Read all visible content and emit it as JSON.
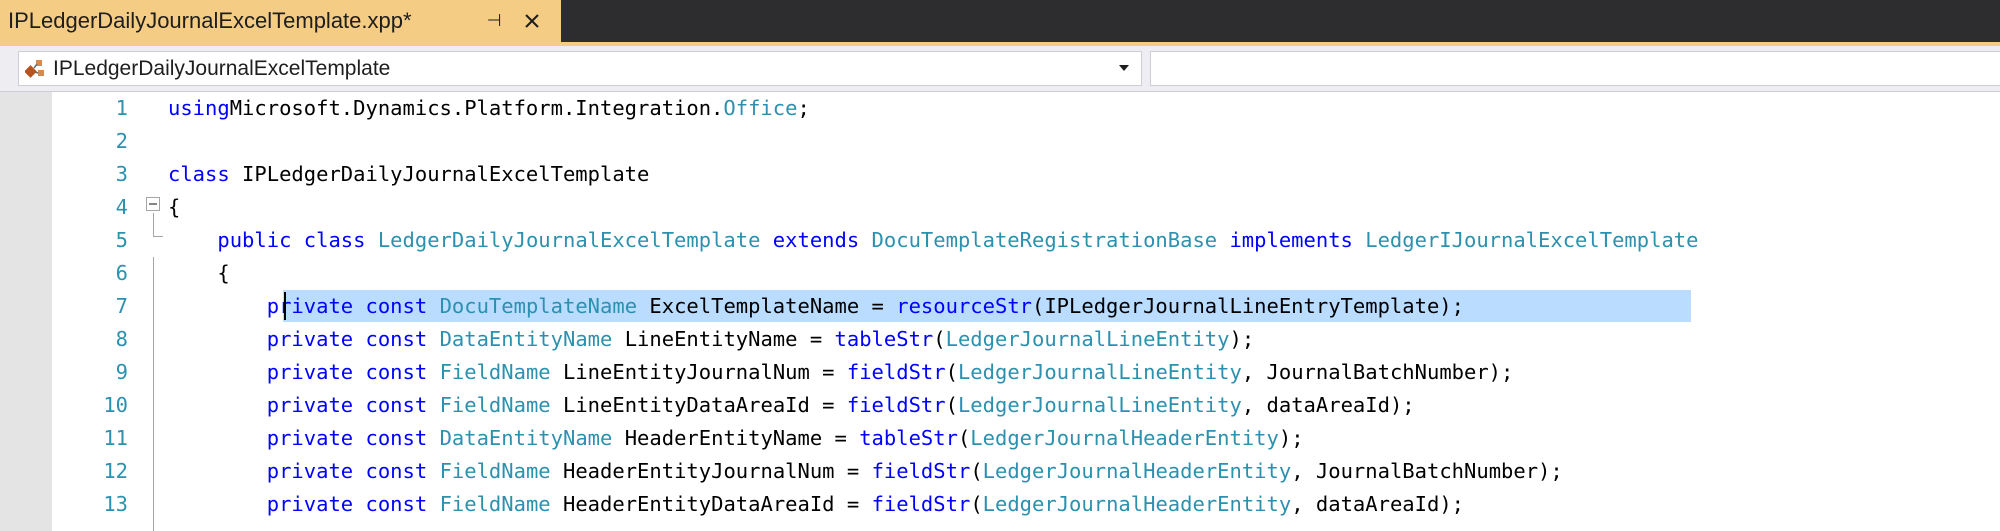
{
  "tab": {
    "title": "IPLedgerDailyJournalExcelTemplate.xpp*",
    "pin_glyph": "⊣",
    "close_icon": "close-icon"
  },
  "navbar": {
    "selected": "IPLedgerDailyJournalExcelTemplate",
    "icon": "class-icon"
  },
  "colors": {
    "tab_active": "#f5cc84",
    "keyword": "#0000ff",
    "type": "#2b91af",
    "line_number": "#2b91af",
    "selection": "#add6ff"
  },
  "editor": {
    "lines": [
      {
        "n": "1",
        "seg": [
          [
            "kw",
            "using"
          ],
          [
            "",
            "Microsoft.Dynamics.Platform.Integration."
          ],
          [
            "ty",
            "Office"
          ],
          [
            "",
            ";"
          ]
        ]
      },
      {
        "n": "2",
        "seg": []
      },
      {
        "n": "3",
        "seg": [
          [
            "kw",
            "class"
          ],
          [
            "",
            " IPLedgerDailyJournalExcelTemplate"
          ]
        ]
      },
      {
        "n": "4",
        "seg": [
          [
            "",
            "{"
          ]
        ]
      },
      {
        "n": "5",
        "seg": [
          [
            "",
            "    "
          ],
          [
            "kw",
            "public"
          ],
          [
            "",
            " "
          ],
          [
            "kw",
            "class"
          ],
          [
            "",
            " "
          ],
          [
            "ty",
            "LedgerDailyJournalExcelTemplate"
          ],
          [
            "",
            " "
          ],
          [
            "kw",
            "extends"
          ],
          [
            "",
            " "
          ],
          [
            "ty",
            "DocuTemplateRegistrationBase"
          ],
          [
            "",
            " "
          ],
          [
            "kw",
            "implements"
          ],
          [
            "",
            " "
          ],
          [
            "ty",
            "LedgerIJournalExcelTemplate"
          ]
        ]
      },
      {
        "n": "6",
        "seg": [
          [
            "",
            "    {"
          ]
        ]
      },
      {
        "n": "7",
        "seg": [
          [
            "",
            "        "
          ],
          [
            "kw",
            "private"
          ],
          [
            "",
            " "
          ],
          [
            "kw",
            "const"
          ],
          [
            "",
            " "
          ],
          [
            "ty",
            "DocuTemplateName"
          ],
          [
            "",
            " ExcelTemplateName = "
          ],
          [
            "kw",
            "resourceStr"
          ],
          [
            "",
            "(IPLedgerJournalLineEntryTemplate);"
          ]
        ]
      },
      {
        "n": "8",
        "seg": [
          [
            "",
            "        "
          ],
          [
            "kw",
            "private"
          ],
          [
            "",
            " "
          ],
          [
            "kw",
            "const"
          ],
          [
            "",
            " "
          ],
          [
            "ty",
            "DataEntityName"
          ],
          [
            "",
            " LineEntityName = "
          ],
          [
            "kw",
            "tableStr"
          ],
          [
            "",
            "("
          ],
          [
            "ty",
            "LedgerJournalLineEntity"
          ],
          [
            "",
            ");"
          ]
        ]
      },
      {
        "n": "9",
        "seg": [
          [
            "",
            "        "
          ],
          [
            "kw",
            "private"
          ],
          [
            "",
            " "
          ],
          [
            "kw",
            "const"
          ],
          [
            "",
            " "
          ],
          [
            "ty",
            "FieldName"
          ],
          [
            "",
            " LineEntityJournalNum = "
          ],
          [
            "kw",
            "fieldStr"
          ],
          [
            "",
            "("
          ],
          [
            "ty",
            "LedgerJournalLineEntity"
          ],
          [
            "",
            ", JournalBatchNumber);"
          ]
        ]
      },
      {
        "n": "10",
        "seg": [
          [
            "",
            "        "
          ],
          [
            "kw",
            "private"
          ],
          [
            "",
            " "
          ],
          [
            "kw",
            "const"
          ],
          [
            "",
            " "
          ],
          [
            "ty",
            "FieldName"
          ],
          [
            "",
            " LineEntityDataAreaId = "
          ],
          [
            "kw",
            "fieldStr"
          ],
          [
            "",
            "("
          ],
          [
            "ty",
            "LedgerJournalLineEntity"
          ],
          [
            "",
            ", dataAreaId);"
          ]
        ]
      },
      {
        "n": "11",
        "seg": [
          [
            "",
            "        "
          ],
          [
            "kw",
            "private"
          ],
          [
            "",
            " "
          ],
          [
            "kw",
            "const"
          ],
          [
            "",
            " "
          ],
          [
            "ty",
            "DataEntityName"
          ],
          [
            "",
            " HeaderEntityName = "
          ],
          [
            "kw",
            "tableStr"
          ],
          [
            "",
            "("
          ],
          [
            "ty",
            "LedgerJournalHeaderEntity"
          ],
          [
            "",
            ");"
          ]
        ]
      },
      {
        "n": "12",
        "seg": [
          [
            "",
            "        "
          ],
          [
            "kw",
            "private"
          ],
          [
            "",
            " "
          ],
          [
            "kw",
            "const"
          ],
          [
            "",
            " "
          ],
          [
            "ty",
            "FieldName"
          ],
          [
            "",
            " HeaderEntityJournalNum = "
          ],
          [
            "kw",
            "fieldStr"
          ],
          [
            "",
            "("
          ],
          [
            "ty",
            "LedgerJournalHeaderEntity"
          ],
          [
            "",
            ", JournalBatchNumber);"
          ]
        ]
      },
      {
        "n": "13",
        "seg": [
          [
            "",
            "        "
          ],
          [
            "kw",
            "private"
          ],
          [
            "",
            " "
          ],
          [
            "kw",
            "const"
          ],
          [
            "",
            " "
          ],
          [
            "ty",
            "FieldName"
          ],
          [
            "",
            " HeaderEntityDataAreaId = "
          ],
          [
            "kw",
            "fieldStr"
          ],
          [
            "",
            "("
          ],
          [
            "ty",
            "LedgerJournalHeaderEntity"
          ],
          [
            "",
            ", dataAreaId);"
          ]
        ]
      }
    ]
  }
}
